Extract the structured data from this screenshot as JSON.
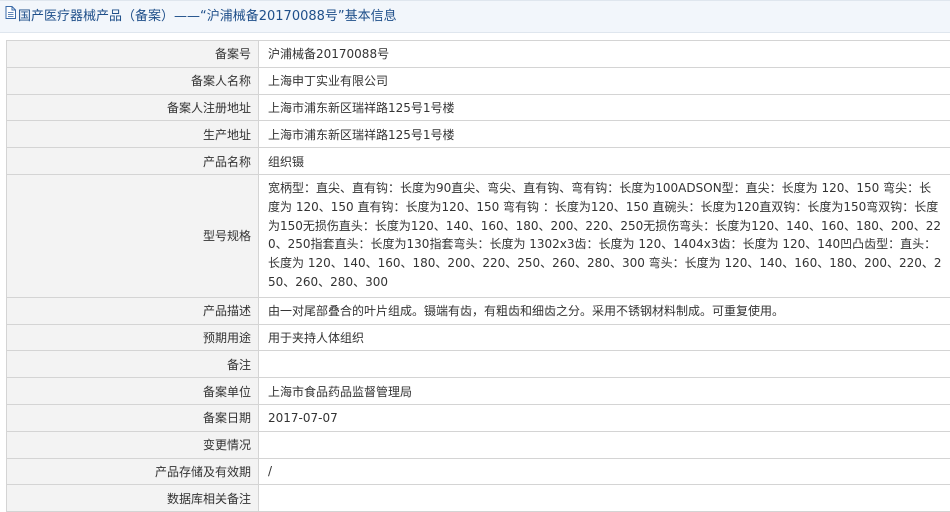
{
  "page": {
    "title": "国产医疗器械产品（备案）——“沪浦械备20170088号”基本信息"
  },
  "record": [
    {
      "label": "备案号",
      "value": "沪浦械备20170088号"
    },
    {
      "label": "备案人名称",
      "value": "上海申丁实业有限公司"
    },
    {
      "label": "备案人注册地址",
      "value": "上海市浦东新区瑞祥路125号1号楼"
    },
    {
      "label": "生产地址",
      "value": "上海市浦东新区瑞祥路125号1号楼"
    },
    {
      "label": "产品名称",
      "value": "组织镊"
    },
    {
      "label": "型号规格",
      "value": "宽柄型：直尖、直有钩：长度为90直尖、弯尖、直有钩、弯有钩：长度为100ADSON型：直尖：长度为 120、150 弯尖：长度为 120、150 直有钩：长度为120、150 弯有钩 ：长度为120、150 直碗头：长度为120直双钩：长度为150弯双钩：长度为150无损伤直头：长度为120、140、160、180、200、220、250无损伤弯头：长度为120、140、160、180、200、220、250指套直头：长度为130指套弯头：长度为 1302x3齿：长度为 120、1404x3齿：长度为 120、140凹凸齿型：直头：长度为 120、140、160、180、200、220、250、260、280、300 弯头：长度为 120、140、160、180、200、220、250、260、280、300"
    },
    {
      "label": "产品描述",
      "value": "由一对尾部叠合的叶片组成。镊端有齿，有粗齿和细齿之分。采用不锈钢材料制成。可重复使用。"
    },
    {
      "label": "预期用途",
      "value": "用于夹持人体组织"
    },
    {
      "label": "备注",
      "value": ""
    },
    {
      "label": "备案单位",
      "value": "上海市食品药品监督管理局"
    },
    {
      "label": "备案日期",
      "value": "2017-07-07"
    },
    {
      "label": "变更情况",
      "value": ""
    },
    {
      "label": "产品存储及有效期",
      "value": "/"
    },
    {
      "label": "数据库相关备注",
      "value": ""
    }
  ]
}
